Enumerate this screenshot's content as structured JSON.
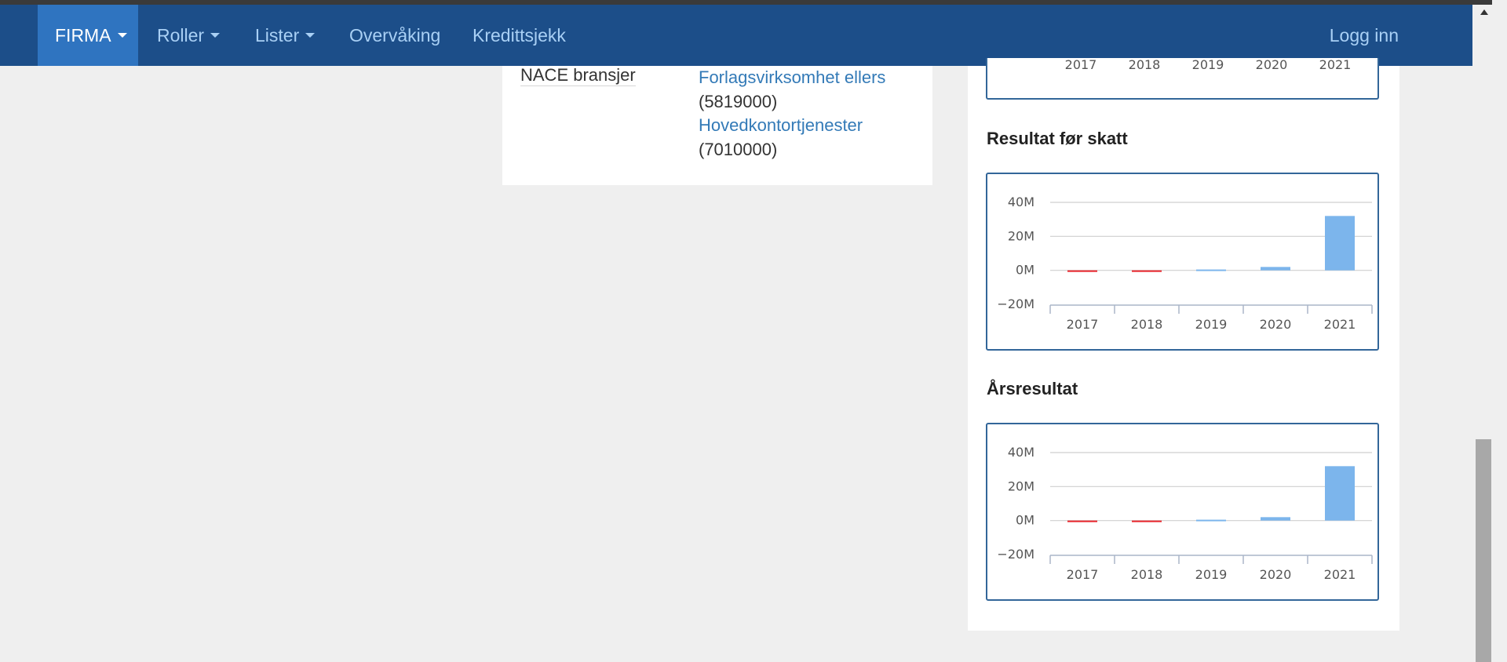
{
  "nav": {
    "items": [
      {
        "label": "FIRMA",
        "dropdown": true,
        "active": true
      },
      {
        "label": "Roller",
        "dropdown": true,
        "active": false
      },
      {
        "label": "Lister",
        "dropdown": true,
        "active": false
      },
      {
        "label": "Overvåking",
        "dropdown": false,
        "active": false
      },
      {
        "label": "Kredittsjekk",
        "dropdown": false,
        "active": false
      }
    ],
    "login": "Logg inn"
  },
  "info": {
    "nace_label": "NACE bransjer",
    "nace": [
      {
        "name": "Forlagsvirksomhet ellers",
        "code": "(5819000)"
      },
      {
        "name": "Hovedkontortjenester",
        "code": "(7010000)"
      }
    ]
  },
  "charts": {
    "top_partial": {
      "categories": [
        "2017",
        "2018",
        "2019",
        "2020",
        "2021"
      ]
    },
    "resultat": {
      "title": "Resultat før skatt"
    },
    "arsresultat": {
      "title": "Årsresultat"
    }
  },
  "colors": {
    "positive": "#7cb5ec",
    "negative": "#e8262d",
    "nav_bg": "#1c4e89",
    "nav_active": "#2f74c0"
  },
  "chart_data": [
    {
      "type": "bar",
      "title": "Resultat før skatt",
      "categories": [
        "2017",
        "2018",
        "2019",
        "2020",
        "2021"
      ],
      "values": [
        -0.6,
        -0.6,
        0.5,
        2.0,
        32.0
      ],
      "yticks": [
        "40M",
        "20M",
        "0M",
        "−20M"
      ],
      "ylim": [
        -20,
        40
      ],
      "grid": true
    },
    {
      "type": "bar",
      "title": "Årsresultat",
      "categories": [
        "2017",
        "2018",
        "2019",
        "2020",
        "2021"
      ],
      "values": [
        -0.6,
        -0.6,
        0.5,
        2.0,
        32.0
      ],
      "yticks": [
        "40M",
        "20M",
        "0M",
        "−20M"
      ],
      "ylim": [
        -20,
        40
      ],
      "grid": true
    }
  ]
}
